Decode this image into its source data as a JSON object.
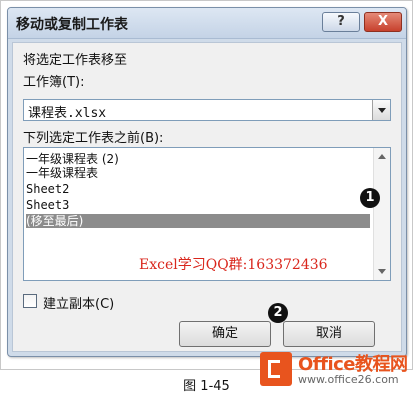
{
  "dialog": {
    "title": "移动或复制工作表",
    "help_icon": "?",
    "close_icon": "X",
    "move_label": "将选定工作表移至",
    "workbook_label": "工作簿(T):",
    "workbook_value": "课程表.xlsx",
    "before_label": "下列选定工作表之前(B):",
    "sheets": [
      {
        "label": "一年级课程表 (2)",
        "selected": false
      },
      {
        "label": "一年级课程表",
        "selected": false
      },
      {
        "label": "Sheet2",
        "selected": false
      },
      {
        "label": "Sheet3",
        "selected": false
      },
      {
        "label": "(移至最后)",
        "selected": true
      }
    ],
    "watermark": "Excel学习QQ群:163372436",
    "copy_checkbox_label": "建立副本(C)",
    "copy_checked": false,
    "ok_label": "确定",
    "cancel_label": "取消"
  },
  "markers": {
    "m1": "1",
    "m2": "2"
  },
  "caption": "图 1-45",
  "logo": {
    "brand": "Office教程网",
    "url": "www.office26.com"
  },
  "colors": {
    "selection": "#8c8c8c",
    "watermark": "#d9261c",
    "logo": "#e8541e"
  }
}
